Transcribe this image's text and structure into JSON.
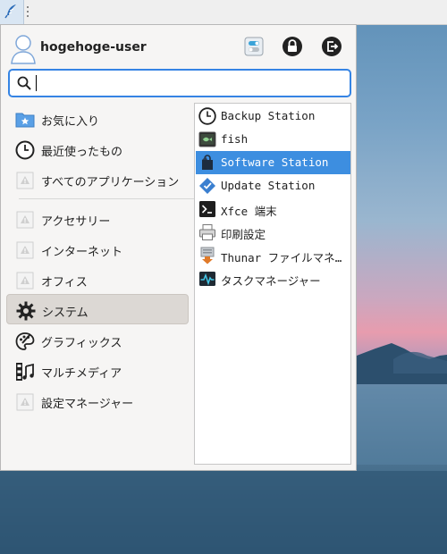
{
  "panel": {
    "launcher_icon": "feather-icon",
    "grip_icon": "panel-grip-icon"
  },
  "user": {
    "name": "hogehoge-user",
    "actions": [
      {
        "name": "settings-toggle-button",
        "icon": "toggle-icon"
      },
      {
        "name": "lock-screen-button",
        "icon": "lock-icon"
      },
      {
        "name": "logout-button",
        "icon": "logout-icon"
      }
    ]
  },
  "search": {
    "value": "",
    "placeholder": ""
  },
  "categories": [
    {
      "label": "お気に入り",
      "icon": "favorites-folder-icon",
      "selected": false
    },
    {
      "label": "最近使ったもの",
      "icon": "clock-icon",
      "selected": false
    },
    {
      "label": "すべてのアプリケーション",
      "icon": "warning-placeholder-icon",
      "selected": false
    },
    {
      "label": "アクセサリー",
      "icon": "warning-placeholder-icon",
      "selected": false
    },
    {
      "label": "インターネット",
      "icon": "warning-placeholder-icon",
      "selected": false
    },
    {
      "label": "オフィス",
      "icon": "warning-placeholder-icon",
      "selected": false
    },
    {
      "label": "システム",
      "icon": "gear-icon",
      "selected": true
    },
    {
      "label": "グラフィックス",
      "icon": "palette-icon",
      "selected": false
    },
    {
      "label": "マルチメディア",
      "icon": "film-music-icon",
      "selected": false
    },
    {
      "label": "設定マネージャー",
      "icon": "warning-placeholder-icon",
      "selected": false
    }
  ],
  "apps": [
    {
      "label": "Backup Station",
      "icon": "clock-icon",
      "selected": false
    },
    {
      "label": "fish",
      "icon": "terminal-fish-icon",
      "selected": false
    },
    {
      "label": "Software Station",
      "icon": "software-station-icon",
      "selected": true
    },
    {
      "label": "Update Station",
      "icon": "update-station-icon",
      "selected": false
    },
    {
      "label": "Xfce 端末",
      "icon": "terminal-icon",
      "selected": false
    },
    {
      "label": "印刷設定",
      "icon": "printer-icon",
      "selected": false
    },
    {
      "label": "Thunar ファイルマネージャー",
      "icon": "file-manager-icon",
      "selected": false
    },
    {
      "label": "タスクマネージャー",
      "icon": "task-manager-icon",
      "selected": false
    }
  ],
  "colors": {
    "accent": "#3d8ee0",
    "search_border": "#3584e4",
    "selected_category": "#dcd8d4"
  }
}
